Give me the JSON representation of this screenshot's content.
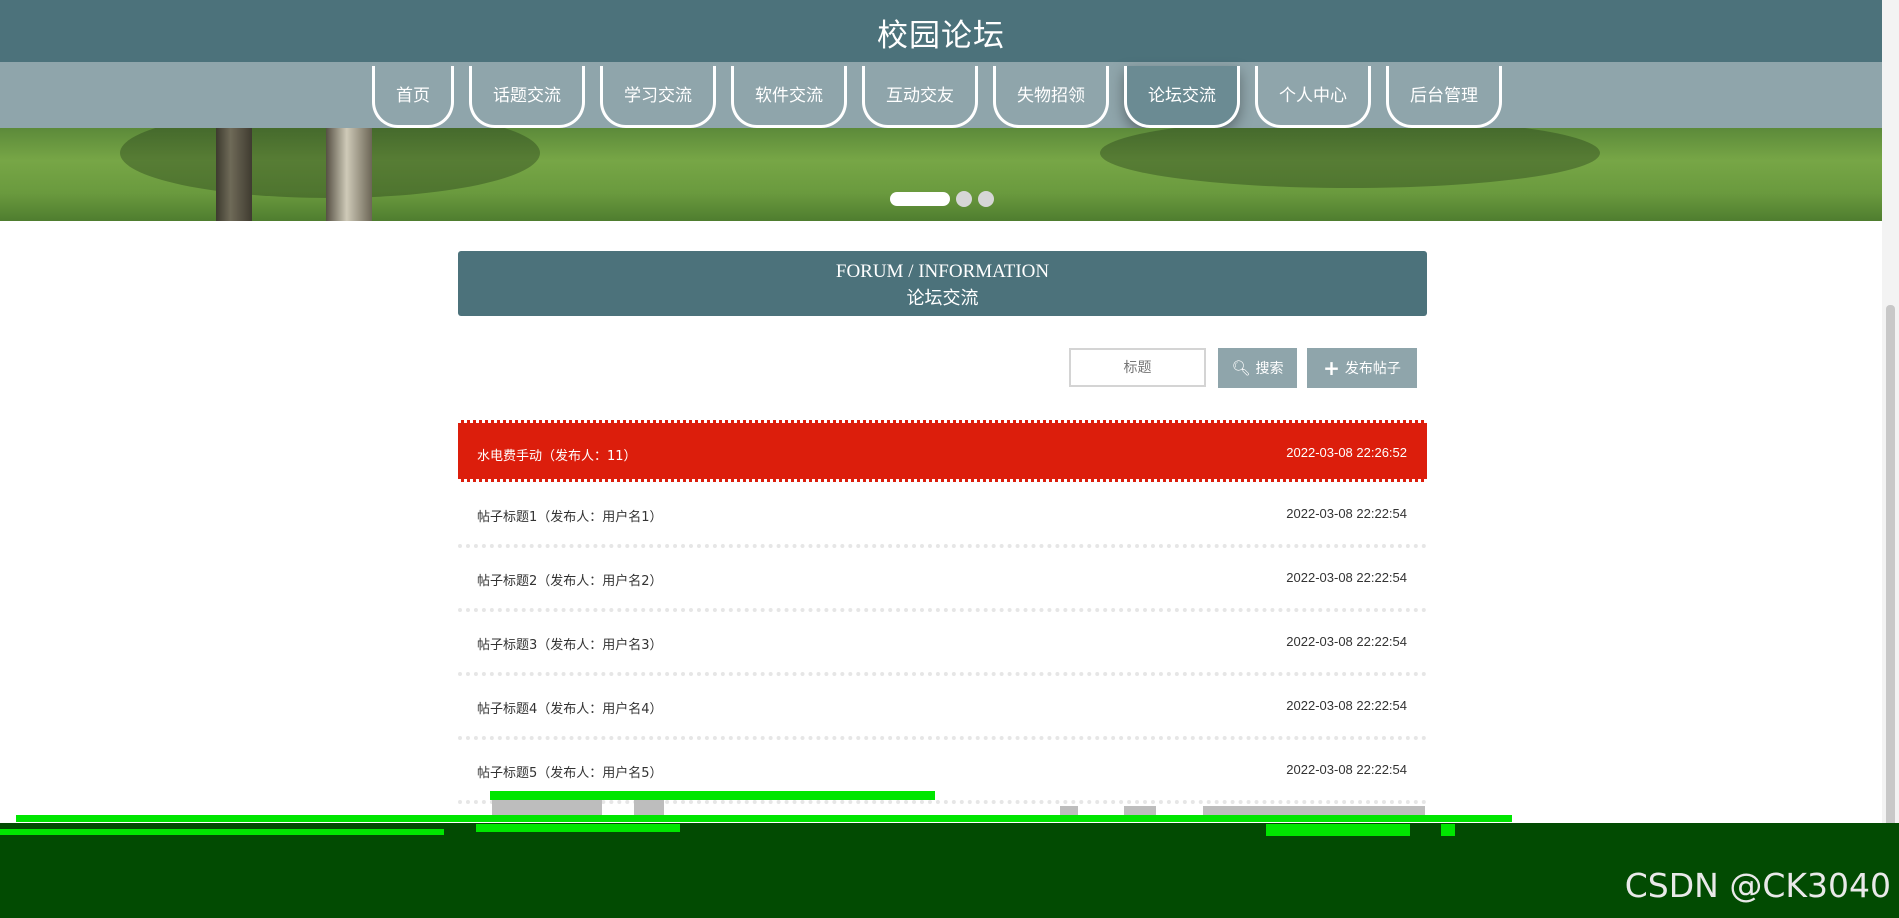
{
  "site": {
    "title": "校园论坛"
  },
  "nav": {
    "items": [
      "首页",
      "话题交流",
      "学习交流",
      "软件交流",
      "互动交友",
      "失物招领",
      "论坛交流",
      "个人中心",
      "后台管理"
    ],
    "active": "论坛交流"
  },
  "section": {
    "title_en": "FORUM / INFORMATION",
    "title_cn": "论坛交流"
  },
  "search": {
    "placeholder": "标题",
    "button_label": "搜索",
    "post_button_label": "发布帖子"
  },
  "posts": [
    {
      "title": "水电费手动（发布人：11）",
      "time": "2022-03-08 22:26:52",
      "highlighted": true
    },
    {
      "title": "帖子标题1（发布人：用户名1）",
      "time": "2022-03-08 22:22:54"
    },
    {
      "title": "帖子标题2（发布人：用户名2）",
      "time": "2022-03-08 22:22:54"
    },
    {
      "title": "帖子标题3（发布人：用户名3）",
      "time": "2022-03-08 22:22:54"
    },
    {
      "title": "帖子标题4（发布人：用户名4）",
      "time": "2022-03-08 22:22:54"
    },
    {
      "title": "帖子标题5（发布人：用户名5）",
      "time": "2022-03-08 22:22:54"
    }
  ],
  "colors": {
    "header": "#4c727b",
    "nav": "#8fa5ab",
    "highlight": "#dc1e0c"
  },
  "watermark": "CSDN @CK3040"
}
